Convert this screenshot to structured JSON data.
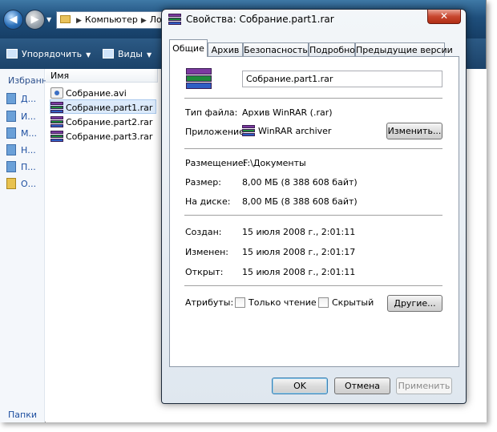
{
  "explorer": {
    "address": [
      "Компьютер",
      "Ло"
    ],
    "toolbar": {
      "organize": "Упорядочить",
      "views": "Виды"
    },
    "nav": {
      "favorites_heading": "Избранн",
      "links": [
        "Д...",
        "И...",
        "М...",
        "Н...",
        "П...",
        "О..."
      ],
      "folders": "Папки"
    },
    "column_name": "Имя",
    "files": [
      {
        "name": "Собрание.avi",
        "icon": "video-file-icon"
      },
      {
        "name": "Собрание.part1.rar",
        "icon": "winrar-icon",
        "selected": true
      },
      {
        "name": "Собрание.part2.rar",
        "icon": "winrar-icon"
      },
      {
        "name": "Собрание.part3.rar",
        "icon": "winrar-icon"
      }
    ]
  },
  "dialog": {
    "title": "Свойства: Собрание.part1.rar",
    "close_glyph": "✕",
    "tabs": [
      {
        "label": "Общие",
        "active": true
      },
      {
        "label": "Архив"
      },
      {
        "label": "Безопасность"
      },
      {
        "label": "Подробно"
      },
      {
        "label": "Предыдущие версии"
      }
    ],
    "filename": "Собрание.part1.rar",
    "file_type": {
      "label": "Тип файла:",
      "value": "Архив WinRAR (.rar)"
    },
    "application": {
      "label": "Приложение:",
      "value": "WinRAR archiver",
      "change_button": "Изменить..."
    },
    "location": {
      "label": "Размещение:",
      "value": "F:\\Документы"
    },
    "size": {
      "label": "Размер:",
      "value": "8,00 МБ (8 388 608 байт)"
    },
    "size_on_disk": {
      "label": "На диске:",
      "value": "8,00 МБ (8 388 608 байт)"
    },
    "created": {
      "label": "Создан:",
      "value": "15 июля 2008 г., 2:01:11"
    },
    "modified": {
      "label": "Изменен:",
      "value": "15 июля 2008 г., 2:01:17"
    },
    "accessed": {
      "label": "Открыт:",
      "value": "15 июля 2008 г., 2:01:11"
    },
    "attributes": {
      "label": "Атрибуты:",
      "readonly": {
        "label": "Только чтение",
        "checked": false
      },
      "hidden": {
        "label": "Скрытый",
        "checked": false
      },
      "other_button": "Другие..."
    },
    "buttons": {
      "ok": "OK",
      "cancel": "Отмена",
      "apply": "Применить"
    }
  },
  "colors": {
    "titlebar_close": "#c8472f",
    "explorer_bar": "#1f4f7c",
    "selection": "#dceafb"
  }
}
